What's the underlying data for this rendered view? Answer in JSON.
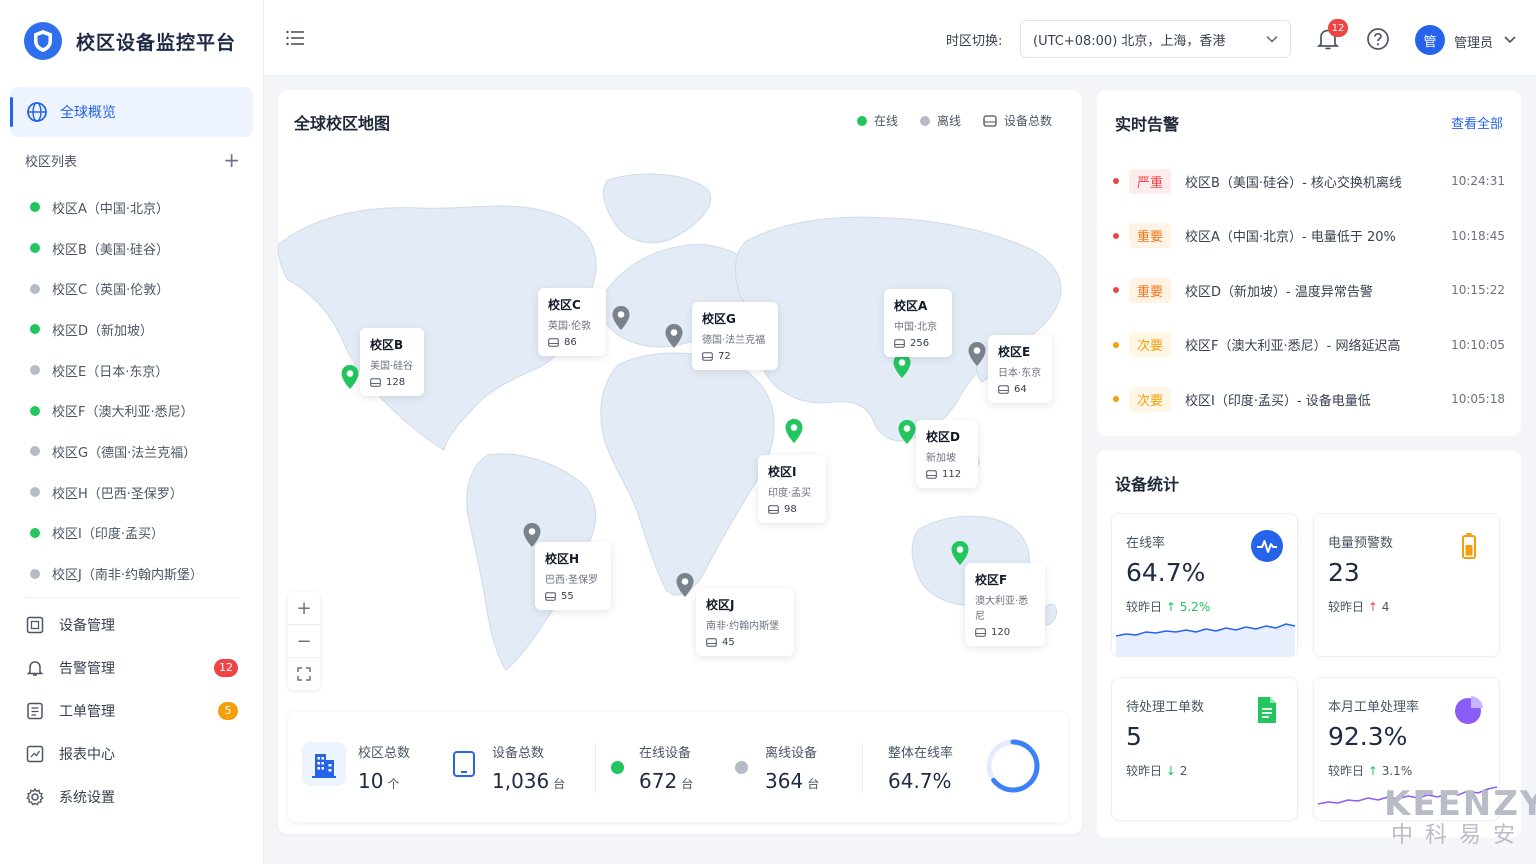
{
  "app": {
    "title": "校区设备监控平台"
  },
  "sidebar": {
    "active_item": "全球概览",
    "campus_header": "校区列表",
    "campuses": [
      {
        "label": "校区A（中国·北京）",
        "status": "online"
      },
      {
        "label": "校区B（美国·硅谷）",
        "status": "online"
      },
      {
        "label": "校区C（英国·伦敦）",
        "status": "offline"
      },
      {
        "label": "校区D（新加坡）",
        "status": "online"
      },
      {
        "label": "校区E（日本·东京）",
        "status": "offline"
      },
      {
        "label": "校区F（澳大利亚·悉尼）",
        "status": "online"
      },
      {
        "label": "校区G（德国·法兰克福）",
        "status": "offline"
      },
      {
        "label": "校区H（巴西·圣保罗）",
        "status": "offline"
      },
      {
        "label": "校区I（印度·孟买）",
        "status": "online"
      },
      {
        "label": "校区J（南非·约翰内斯堡）",
        "status": "offline"
      }
    ],
    "menu": [
      {
        "label": "设备管理",
        "icon": "device-icon"
      },
      {
        "label": "告警管理",
        "icon": "bell-icon",
        "badge": "12"
      },
      {
        "label": "工单管理",
        "icon": "order-icon",
        "badge": "5"
      },
      {
        "label": "报表中心",
        "icon": "report-icon"
      },
      {
        "label": "系统设置",
        "icon": "gear-icon"
      }
    ]
  },
  "header": {
    "timezone_label": "时区切换:",
    "timezone_value": "(UTC+08:00) 北京，上海，香港",
    "notification_count": "12",
    "avatar_text": "管",
    "user_name": "管理员"
  },
  "map": {
    "title": "全球校区地图",
    "legend": {
      "online": "在线",
      "offline": "离线",
      "total": "设备总数"
    },
    "campuses": [
      {
        "name": "校区A",
        "location": "中国·北京",
        "count": "256",
        "status": "online"
      },
      {
        "name": "校区B",
        "location": "美国·硅谷",
        "count": "128",
        "status": "online"
      },
      {
        "name": "校区C",
        "location": "英国·伦敦",
        "count": "86",
        "status": "offline"
      },
      {
        "name": "校区D",
        "location": "新加坡",
        "count": "112",
        "status": "online"
      },
      {
        "name": "校区E",
        "location": "日本·东京",
        "count": "64",
        "status": "offline"
      },
      {
        "name": "校区F",
        "location": "澳大利亚·悉尼",
        "count": "120",
        "status": "online"
      },
      {
        "name": "校区G",
        "location": "德国·法兰克福",
        "count": "72",
        "status": "offline"
      },
      {
        "name": "校区H",
        "location": "巴西·圣保罗",
        "count": "55",
        "status": "offline"
      },
      {
        "name": "校区I",
        "location": "印度·孟买",
        "count": "98",
        "status": "online"
      },
      {
        "name": "校区J",
        "location": "南非·约翰内斯堡",
        "count": "45",
        "status": "offline"
      }
    ],
    "zoom": {
      "in": "+",
      "out": "−"
    }
  },
  "summary": {
    "campus_total": {
      "label": "校区总数",
      "value": "10",
      "unit": "个"
    },
    "device_total": {
      "label": "设备总数",
      "value": "1,036",
      "unit": "台"
    },
    "online": {
      "label": "在线设备",
      "value": "672",
      "unit": "台"
    },
    "offline": {
      "label": "离线设备",
      "value": "364",
      "unit": "台"
    },
    "rate": {
      "label": "整体在线率",
      "value": "64.7%",
      "fraction": 0.647
    }
  },
  "alarms": {
    "title": "实时告警",
    "view_all": "查看全部",
    "items": [
      {
        "level": "严重",
        "severity": "critical",
        "text": "校区B（美国·硅谷）- 核心交换机离线",
        "time": "10:24:31"
      },
      {
        "level": "重要",
        "severity": "major",
        "text": "校区A（中国·北京）- 电量低于 20%",
        "time": "10:18:45"
      },
      {
        "level": "重要",
        "severity": "major",
        "text": "校区D（新加坡）- 温度异常告警",
        "time": "10:15:22"
      },
      {
        "level": "次要",
        "severity": "minor",
        "text": "校区F（澳大利亚·悉尼）- 网络延迟高",
        "time": "10:10:05"
      },
      {
        "level": "次要",
        "severity": "minor",
        "text": "校区I（印度·孟买）- 设备电量低",
        "time": "10:05:18"
      }
    ]
  },
  "stats": {
    "title": "设备统计",
    "compare_label": "较昨日",
    "cards": [
      {
        "label": "在线率",
        "value": "64.7%",
        "change": "5.2%",
        "direction": "up"
      },
      {
        "label": "电量预警数",
        "value": "23",
        "change": "4",
        "direction": "up"
      },
      {
        "label": "待处理工单数",
        "value": "5",
        "change": "2",
        "direction": "down"
      },
      {
        "label": "本月工单处理率",
        "value": "92.3%",
        "change": "3.1%",
        "direction": "up"
      }
    ]
  },
  "watermark": {
    "brand": "KEENZY",
    "subtitle": "中科易安"
  },
  "colors": {
    "primary": "#2563eb",
    "online": "#22c55e",
    "offline": "#9aa0aa",
    "critical": "#ef4444",
    "major": "#f97316",
    "minor": "#f59e0b"
  }
}
